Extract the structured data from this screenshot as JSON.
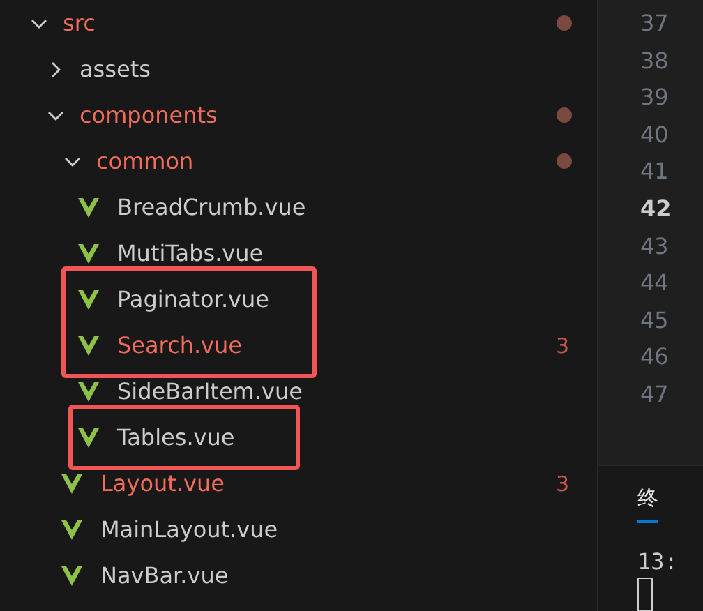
{
  "explorer": {
    "tree": [
      {
        "kind": "folder",
        "name": "src",
        "expanded": true,
        "modified": true,
        "changes_dot": true,
        "children": [
          {
            "kind": "folder",
            "name": "assets",
            "expanded": false,
            "modified": false,
            "changes_dot": false
          },
          {
            "kind": "folder",
            "name": "components",
            "expanded": true,
            "modified": true,
            "changes_dot": true,
            "children": [
              {
                "kind": "folder",
                "name": "common",
                "expanded": true,
                "modified": true,
                "changes_dot": true,
                "children": [
                  {
                    "kind": "file",
                    "name": "BreadCrumb.vue",
                    "modified": false,
                    "outlined": false
                  },
                  {
                    "kind": "file",
                    "name": "MutiTabs.vue",
                    "modified": false,
                    "outlined": false
                  },
                  {
                    "kind": "file",
                    "name": "Paginator.vue",
                    "modified": false,
                    "outlined": true
                  },
                  {
                    "kind": "file",
                    "name": "Search.vue",
                    "modified": true,
                    "badge": "3",
                    "outlined": true
                  },
                  {
                    "kind": "file",
                    "name": "SideBarItem.vue",
                    "modified": false,
                    "outlined": false
                  },
                  {
                    "kind": "file",
                    "name": "Tables.vue",
                    "modified": false,
                    "outlined": true
                  }
                ]
              },
              {
                "kind": "file",
                "name": "Layout.vue",
                "modified": true,
                "badge": "3",
                "outlined": false
              },
              {
                "kind": "file",
                "name": "MainLayout.vue",
                "modified": false,
                "outlined": false
              },
              {
                "kind": "file",
                "name": "NavBar.vue",
                "modified": false,
                "outlined": false
              }
            ]
          }
        ]
      }
    ]
  },
  "editor": {
    "line_numbers": [
      {
        "number": "37",
        "current": false
      },
      {
        "number": "38",
        "current": false
      },
      {
        "number": "39",
        "current": false
      },
      {
        "number": "40",
        "current": false
      },
      {
        "number": "41",
        "current": false
      },
      {
        "number": "42",
        "current": true
      },
      {
        "number": "43",
        "current": false
      },
      {
        "number": "44",
        "current": false
      },
      {
        "number": "45",
        "current": false
      },
      {
        "number": "46",
        "current": false
      },
      {
        "number": "47",
        "current": false
      }
    ]
  },
  "panel": {
    "tabs": [
      {
        "label": "终",
        "selected": true
      }
    ],
    "terminal_lines": [
      "13:"
    ]
  }
}
